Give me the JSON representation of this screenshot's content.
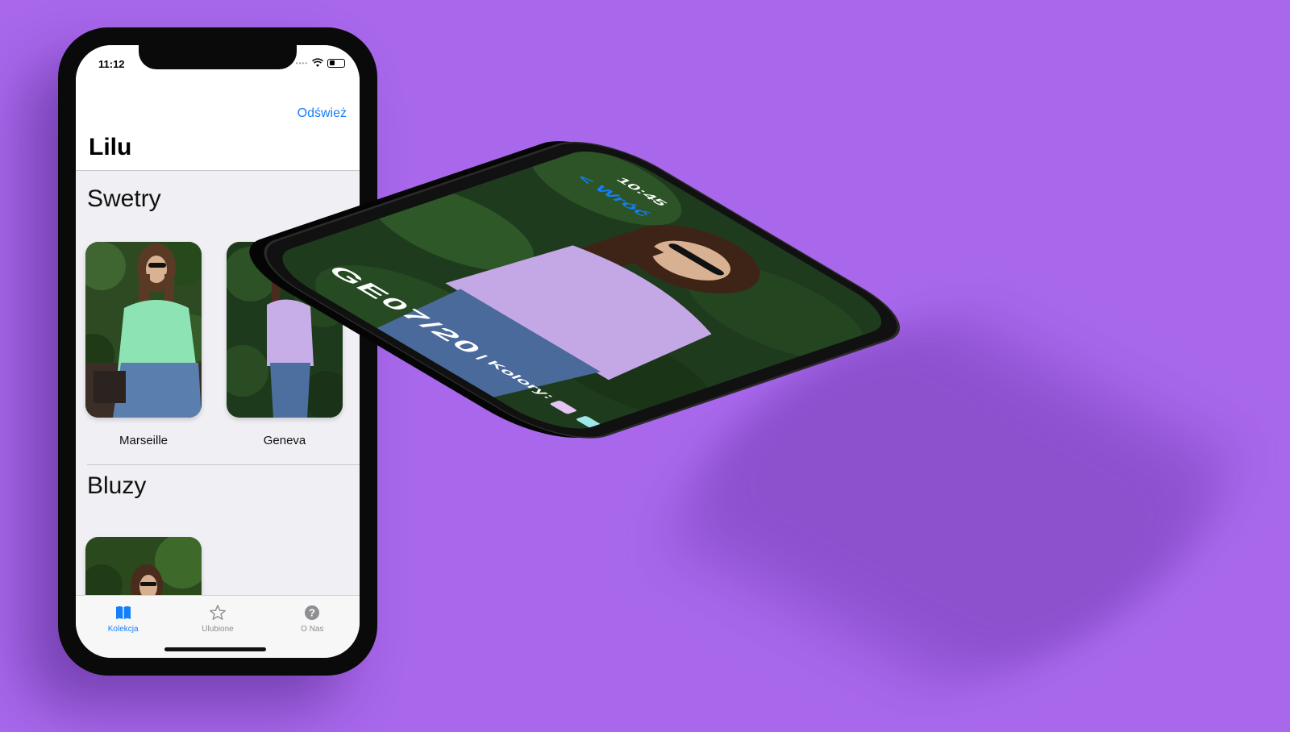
{
  "left_phone": {
    "status": {
      "time": "11:12"
    },
    "nav": {
      "refresh_label": "Odśwież",
      "title": "Lilu"
    },
    "sections": [
      {
        "title": "Swetry",
        "products": [
          {
            "name": "Marseille",
            "sweater_color": "#8ee3b4"
          },
          {
            "name": "Geneva",
            "sweater_color": "#c8aee8"
          }
        ]
      },
      {
        "title": "Bluzy",
        "products": [
          {
            "name": "",
            "sweater_color": "#ffffff"
          }
        ]
      }
    ],
    "tabs": [
      {
        "label": "Kolekcja",
        "icon": "book-icon",
        "active": true
      },
      {
        "label": "Ulubione",
        "icon": "star-icon",
        "active": false
      },
      {
        "label": "O Nas",
        "icon": "question-icon",
        "active": false
      }
    ],
    "colors": {
      "accent": "#147efb"
    }
  },
  "right_phone": {
    "status": {
      "time": "10:45"
    },
    "back_label": "< Wróć",
    "product_code": "GE07/20",
    "colors_label": "| Kolory:",
    "swatches": [
      "#e4c4f2",
      "#9ee8ec",
      "#ffffff",
      "#e53935"
    ]
  },
  "colors": {
    "background": "#a968ec"
  }
}
